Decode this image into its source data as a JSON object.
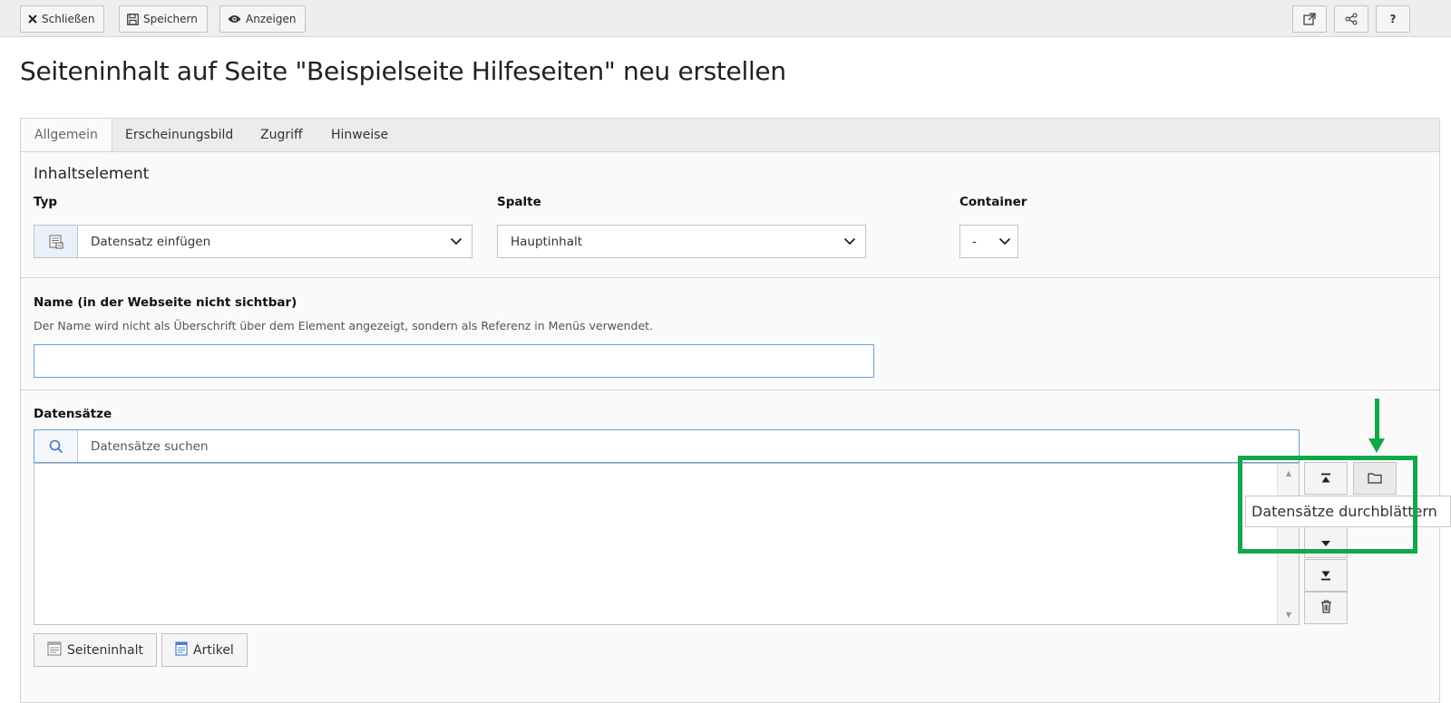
{
  "toolbar": {
    "close_label": "Schließen",
    "save_label": "Speichern",
    "view_label": "Anzeigen",
    "help_label": "?"
  },
  "page": {
    "title": "Seiteninhalt auf Seite \"Beispielseite Hilfeseiten\" neu erstellen"
  },
  "tabs": [
    {
      "label": "Allgemein",
      "active": true
    },
    {
      "label": "Erscheinungsbild",
      "active": false
    },
    {
      "label": "Zugriff",
      "active": false
    },
    {
      "label": "Hinweise",
      "active": false
    }
  ],
  "content_element": {
    "section_title": "Inhaltselement",
    "type": {
      "label": "Typ",
      "value": "Datensatz einfügen"
    },
    "column": {
      "label": "Spalte",
      "value": "Hauptinhalt"
    },
    "container": {
      "label": "Container",
      "value": "-"
    }
  },
  "name_field": {
    "label": "Name (in der Webseite nicht sichtbar)",
    "help": "Der Name wird nicht als Überschrift über dem Element angezeigt, sondern als Referenz in Menüs verwendet.",
    "value": ""
  },
  "records": {
    "label": "Datensätze",
    "search_placeholder": "Datensätze suchen",
    "tooltip": "Datensätze durchblättern",
    "add_buttons": [
      {
        "label": "Seiteninhalt"
      },
      {
        "label": "Artikel"
      }
    ]
  },
  "colors": {
    "highlight": "#11a84a",
    "focus_border": "#6aa1d8"
  }
}
